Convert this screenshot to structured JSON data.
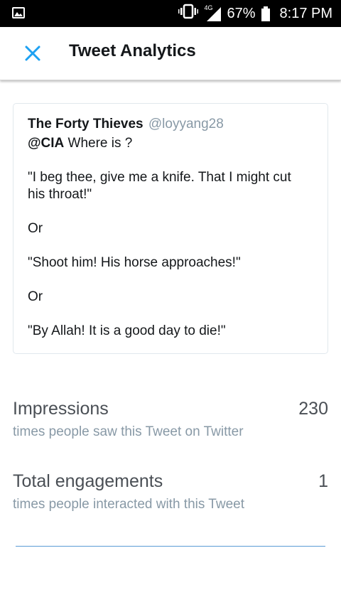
{
  "status_bar": {
    "network_label": "4G",
    "battery_percent": "67%",
    "time": "8:17 PM",
    "icons": [
      "gallery-icon",
      "vibrate-icon",
      "signal-icon",
      "battery-icon"
    ]
  },
  "header": {
    "title": "Tweet Analytics",
    "close_icon": "close-icon",
    "accent_color": "#1da1f2"
  },
  "tweet": {
    "author_name": "The Forty Thieves",
    "handle": "@loyyang28",
    "mention": "@CIA",
    "first_line_rest": " Where is ?",
    "line_2": "\"I beg thee, give me a knife. That I might cut his throat!\"",
    "line_3": "Or",
    "line_4": "\"Shoot him! His horse approaches!\"",
    "line_5": "Or",
    "line_6": "\"By Allah! It is a good day to die!\""
  },
  "metrics": [
    {
      "label": "Impressions",
      "value": "230",
      "description": "times people saw this Tweet on Twitter"
    },
    {
      "label": "Total engagements",
      "value": "1",
      "description": "times people interacted with this Tweet"
    }
  ]
}
